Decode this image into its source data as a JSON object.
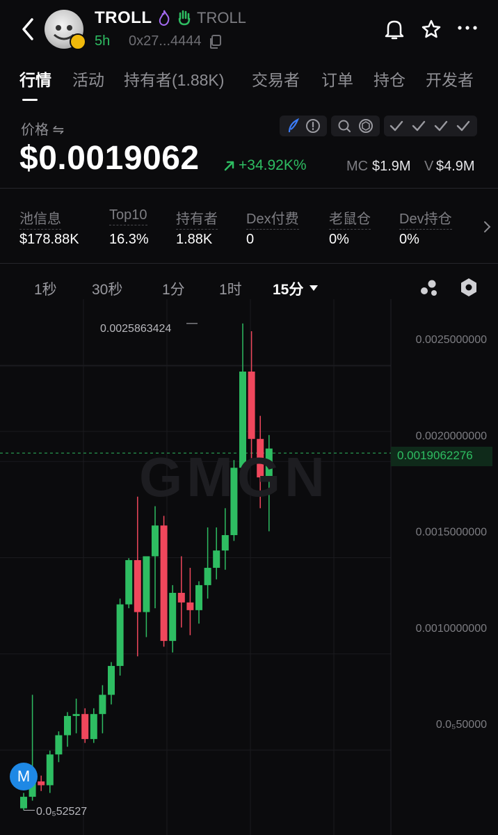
{
  "header": {
    "token_name": "TROLL",
    "token_sub": "TROLL",
    "age": "5h",
    "address": "0x27...4444",
    "icons": [
      "back-arrow-icon",
      "flame-icon",
      "hand-icon",
      "copy-icon",
      "bell-icon",
      "star-icon",
      "more-icon"
    ]
  },
  "tabs": [
    "行情",
    "活动",
    "持有者(1.88K)",
    "交易者",
    "订单",
    "持仓",
    "开发者"
  ],
  "price": {
    "label": "价格 ⇋",
    "value": "$0.0019062",
    "change": "+34.92K%",
    "mc_label": "MC",
    "mc_value": "$1.9M",
    "v_label": "V",
    "v_value": "$4.9M"
  },
  "stats": [
    {
      "label": "池信息",
      "value": "$178.88K"
    },
    {
      "label": "Top10",
      "value": "16.3%"
    },
    {
      "label": "持有者",
      "value": "1.88K"
    },
    {
      "label": "Dex付费",
      "value": "0"
    },
    {
      "label": "老鼠仓",
      "value": "0%"
    },
    {
      "label": "Dev持仓",
      "value": "0%"
    }
  ],
  "timeframes": {
    "items": [
      "1秒",
      "30秒",
      "1分",
      "1时",
      "15分"
    ],
    "selected": "15分"
  },
  "chart_data": {
    "type": "candlestick",
    "y_ticks": [
      "0.0025000000",
      "0.0020000000",
      "0.0015000000",
      "0.0010000000",
      "0.0₅50000"
    ],
    "current_price": "0.0019062276",
    "high_label": "0.0025863424",
    "low_label": "0.0₅52527",
    "watermark": "GMGN",
    "marker": "M",
    "candles": [
      {
        "o": 6e-05,
        "h": 0.00014,
        "l": 5e-05,
        "c": 0.00012
      },
      {
        "o": 0.00012,
        "h": 0.00065,
        "l": 0.0001,
        "c": 0.0002
      },
      {
        "o": 0.0002,
        "h": 0.00023,
        "l": 0.00015,
        "c": 0.00018
      },
      {
        "o": 0.00018,
        "h": 0.00036,
        "l": 0.00014,
        "c": 0.00034
      },
      {
        "o": 0.00034,
        "h": 0.00046,
        "l": 0.0003,
        "c": 0.00044
      },
      {
        "o": 0.00044,
        "h": 0.00056,
        "l": 0.00038,
        "c": 0.00054
      },
      {
        "o": 0.00054,
        "h": 0.00063,
        "l": 0.00045,
        "c": 0.00055
      },
      {
        "o": 0.00055,
        "h": 0.00058,
        "l": 0.0004,
        "c": 0.00042
      },
      {
        "o": 0.00042,
        "h": 0.00058,
        "l": 0.0004,
        "c": 0.00055
      },
      {
        "o": 0.00055,
        "h": 0.0007,
        "l": 0.00045,
        "c": 0.00065
      },
      {
        "o": 0.00065,
        "h": 0.00082,
        "l": 0.0006,
        "c": 0.0008
      },
      {
        "o": 0.0008,
        "h": 0.00115,
        "l": 0.00075,
        "c": 0.00112
      },
      {
        "o": 0.00112,
        "h": 0.00136,
        "l": 0.0011,
        "c": 0.00135
      },
      {
        "o": 0.00135,
        "h": 0.00168,
        "l": 0.00085,
        "c": 0.00108
      },
      {
        "o": 0.00108,
        "h": 0.00125,
        "l": 0.00095,
        "c": 0.00137
      },
      {
        "o": 0.00137,
        "h": 0.00163,
        "l": 0.0011,
        "c": 0.00153
      },
      {
        "o": 0.00153,
        "h": 0.00158,
        "l": 0.0009,
        "c": 0.00093
      },
      {
        "o": 0.00093,
        "h": 0.00122,
        "l": 0.00087,
        "c": 0.00118
      },
      {
        "o": 0.00118,
        "h": 0.00137,
        "l": 0.001,
        "c": 0.00113
      },
      {
        "o": 0.00113,
        "h": 0.00131,
        "l": 0.00096,
        "c": 0.00109
      },
      {
        "o": 0.00109,
        "h": 0.00124,
        "l": 0.00102,
        "c": 0.00122
      },
      {
        "o": 0.00122,
        "h": 0.00152,
        "l": 0.00115,
        "c": 0.00131
      },
      {
        "o": 0.00131,
        "h": 0.00152,
        "l": 0.00125,
        "c": 0.0014
      },
      {
        "o": 0.0014,
        "h": 0.00162,
        "l": 0.0013,
        "c": 0.00148
      },
      {
        "o": 0.00148,
        "h": 0.00187,
        "l": 0.00145,
        "c": 0.00183
      },
      {
        "o": 0.00183,
        "h": 0.00258,
        "l": 0.0018,
        "c": 0.00233
      },
      {
        "o": 0.00233,
        "h": 0.00254,
        "l": 0.00188,
        "c": 0.00198
      },
      {
        "o": 0.00198,
        "h": 0.0021,
        "l": 0.00162,
        "c": 0.00178
      },
      {
        "o": 0.00178,
        "h": 0.002,
        "l": 0.0015,
        "c": 0.00193
      }
    ]
  }
}
